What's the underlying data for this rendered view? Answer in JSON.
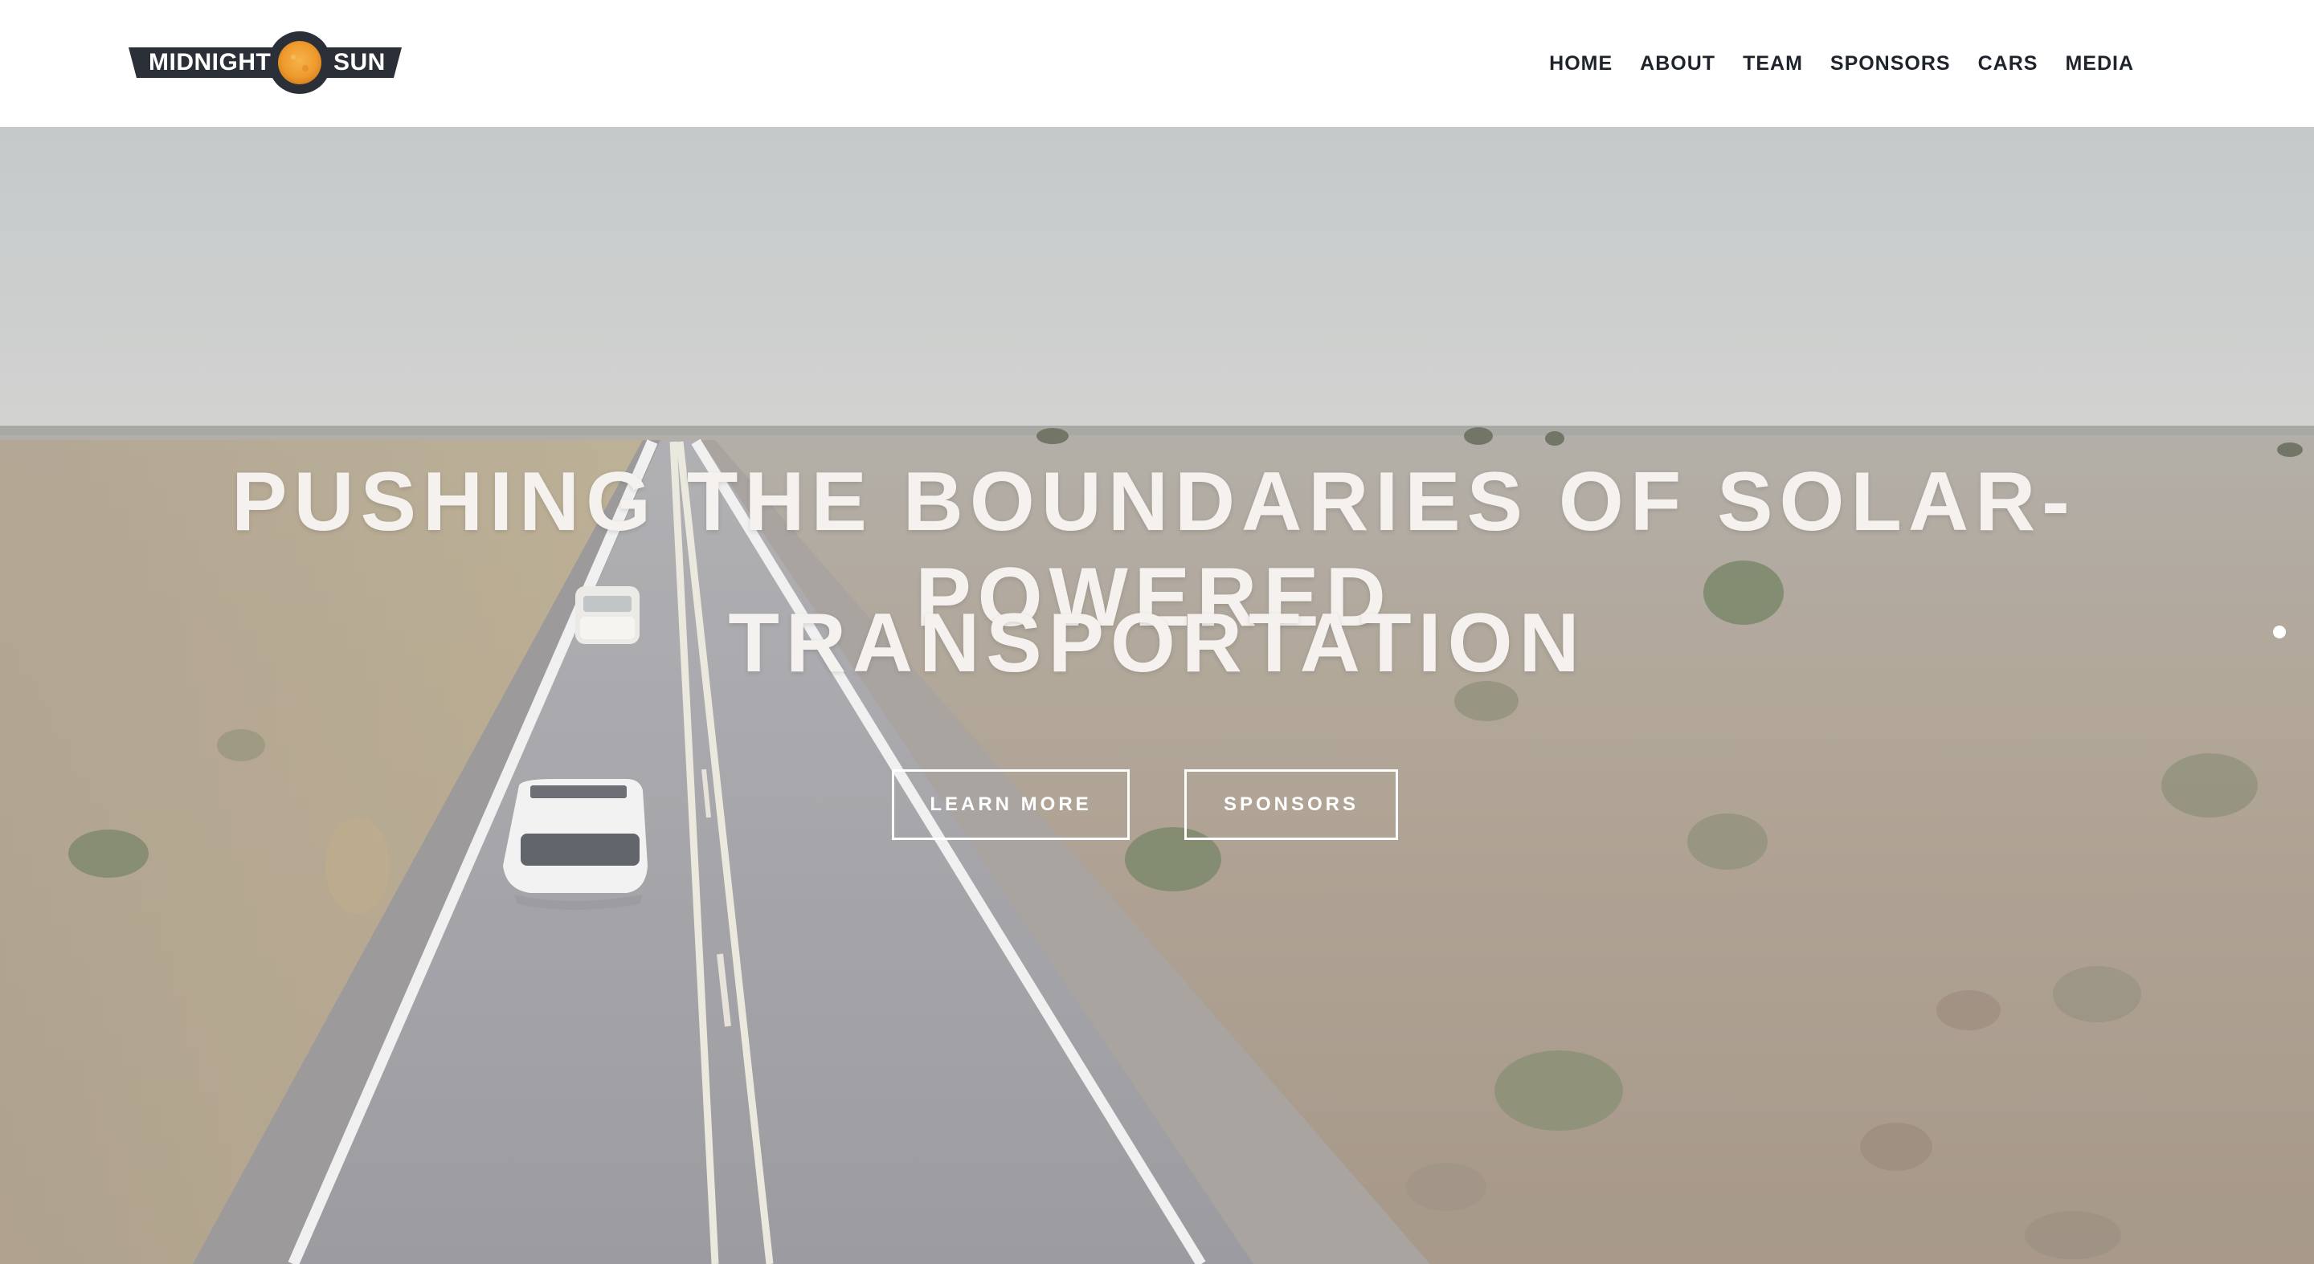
{
  "brand": {
    "name_left": "MIDNIGHT",
    "name_right": "SUN",
    "badge_color": "#2b2f38",
    "sun_color": "#f0a23a"
  },
  "nav": {
    "items": [
      {
        "label": "HOME"
      },
      {
        "label": "ABOUT"
      },
      {
        "label": "TEAM"
      },
      {
        "label": "SPONSORS"
      },
      {
        "label": "CARS"
      },
      {
        "label": "MEDIA"
      }
    ]
  },
  "hero": {
    "headline_line1": "PUSHING THE BOUNDARIES OF SOLAR-POWERED",
    "headline_line2": "TRANSPORTATION",
    "primary_button": "LEARN MORE",
    "secondary_button": "SPONSORS",
    "background_icon": "desert-highway-photo"
  },
  "carousel": {
    "active_index": 1,
    "dot_count": 1
  }
}
